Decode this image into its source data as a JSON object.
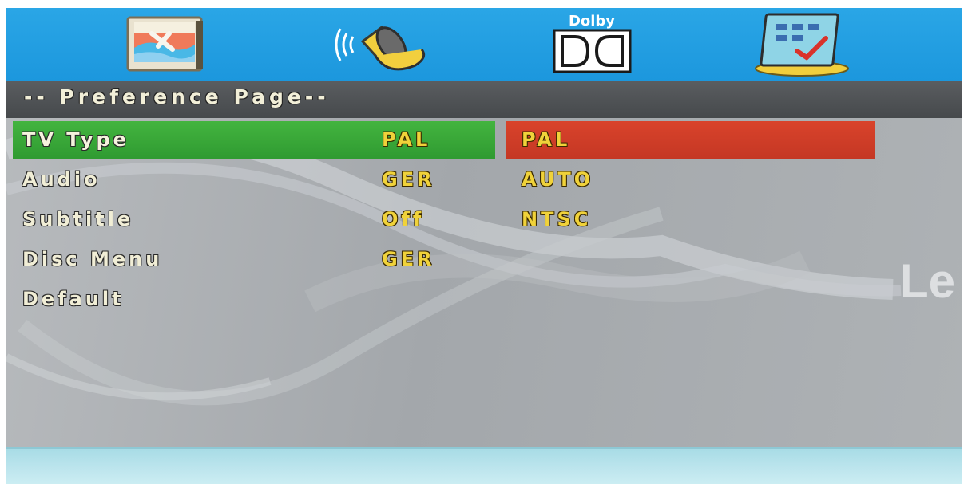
{
  "header": {
    "tabs": [
      {
        "icon": "general-setup-icon"
      },
      {
        "icon": "audio-speaker-icon"
      },
      {
        "icon": "dolby-icon",
        "label": "Dolby"
      },
      {
        "icon": "preference-icon"
      }
    ]
  },
  "page": {
    "title": "-- Preference Page--"
  },
  "menu": {
    "items": [
      {
        "label": "TV Type",
        "value": "PAL"
      },
      {
        "label": "Audio",
        "value": "GER"
      },
      {
        "label": "Subtitle",
        "value": "Off"
      },
      {
        "label": "Disc Menu",
        "value": "GER"
      },
      {
        "label": "Default",
        "value": ""
      }
    ]
  },
  "options": {
    "items": [
      "PAL",
      "AUTO",
      "NTSC"
    ]
  },
  "watermark": "Le",
  "colors": {
    "icon_bar": "#1f9ae0",
    "header_bar": "#4d5053",
    "selected_item": "#3aa83a",
    "selected_option": "#cf3c27",
    "value_text": "#f0d23a",
    "label_text": "#f1eed6",
    "bottom_bar": "#bfe6ee"
  }
}
